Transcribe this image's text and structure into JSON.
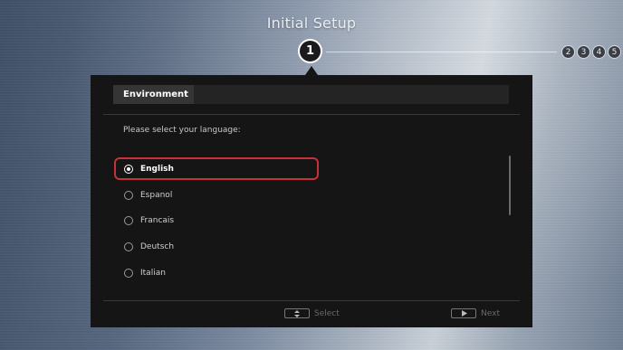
{
  "header": {
    "title": "Initial Setup"
  },
  "steps": {
    "current": "1",
    "upcoming": [
      "2",
      "3",
      "4",
      "5"
    ]
  },
  "panel": {
    "tab_label": "Environment",
    "prompt": "Please select your language:",
    "languages": [
      {
        "label": "English",
        "selected": true
      },
      {
        "label": "Espanol",
        "selected": false
      },
      {
        "label": "Francais",
        "selected": false
      },
      {
        "label": "Deutsch",
        "selected": false
      },
      {
        "label": "Italian",
        "selected": false
      }
    ],
    "footer": {
      "select_label": "Select",
      "select_icon": "up-down-arrows-icon",
      "next_label": "Next",
      "next_icon": "play-arrow-icon"
    }
  },
  "colors": {
    "highlight_border": "#c8303b",
    "panel_bg": "#151515"
  }
}
